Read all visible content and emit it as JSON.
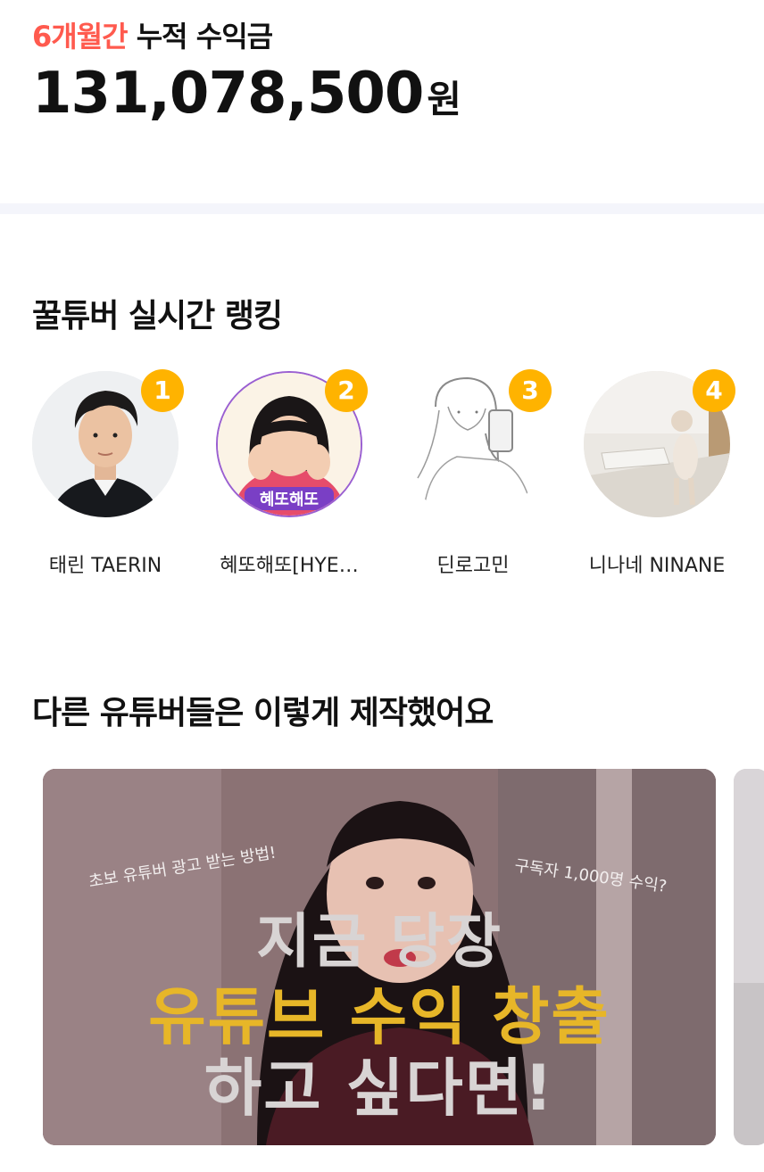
{
  "earnings": {
    "period": "6개월간",
    "label": "누적 수익금",
    "amount": "131,078,500",
    "unit": "원"
  },
  "ranking": {
    "title": "꿀튜버 실시간 랭킹",
    "items": [
      {
        "rank": "1",
        "name": "태린 TAERIN"
      },
      {
        "rank": "2",
        "name": "혜또해또[HYE…"
      },
      {
        "rank": "3",
        "name": "딘로고민"
      },
      {
        "rank": "4",
        "name": "니나네 NINANE"
      }
    ],
    "badge_color": "#ffb300"
  },
  "showcase": {
    "title": "다른 유튜버들은 이렇게 제작했어요",
    "video": {
      "caption_left": "초보 유튜버 광고 받는 방법!",
      "caption_right": "구독자 1,000명 수익?",
      "line1": "지금 당장",
      "line2": "유튜브 수익 창출",
      "line3": "하고 싶다면!"
    },
    "avatar2_logo": "혜또해또"
  },
  "colors": {
    "accent": "#ff5a4e",
    "badge": "#ffb300",
    "divider": "#f4f5fb"
  }
}
